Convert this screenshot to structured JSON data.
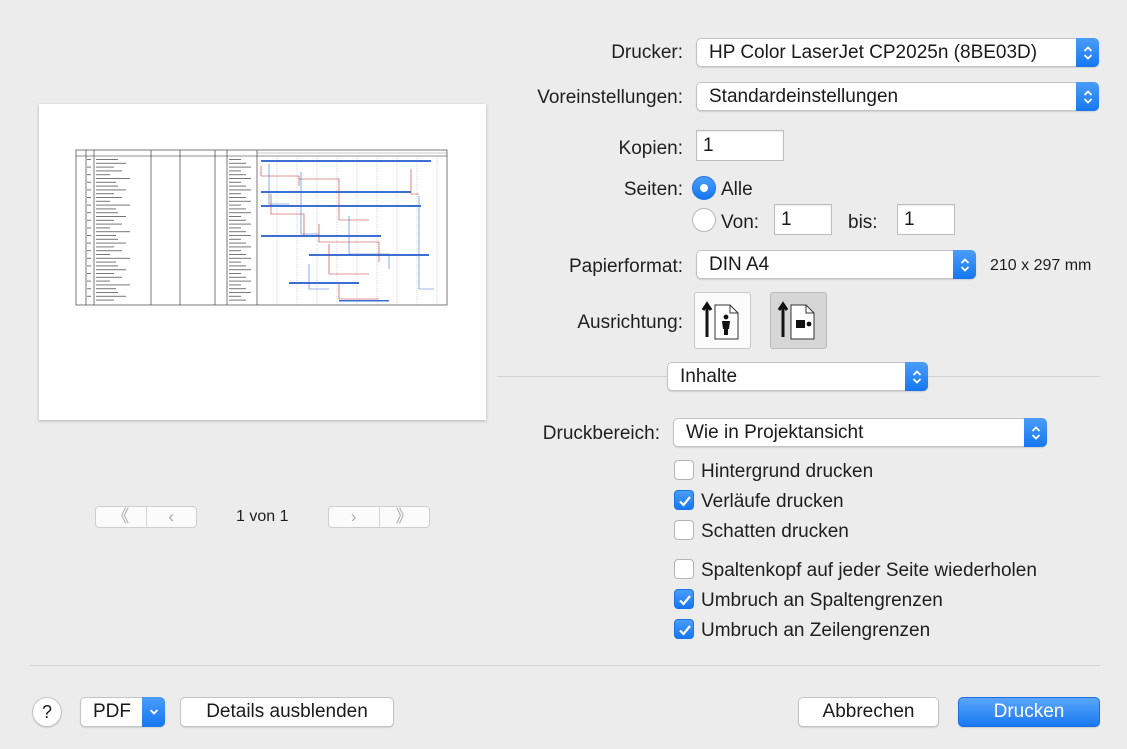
{
  "printer": {
    "label": "Drucker:",
    "value": "HP Color LaserJet CP2025n (8BE03D)"
  },
  "presets": {
    "label": "Voreinstellungen:",
    "value": "Standardeinstellungen"
  },
  "copies": {
    "label": "Kopien:",
    "value": "1"
  },
  "pages": {
    "label": "Seiten:",
    "all_label": "Alle",
    "from_label": "Von:",
    "from_value": "1",
    "to_label": "bis:",
    "to_value": "1",
    "selected": "all"
  },
  "paper": {
    "label": "Papierformat:",
    "value": "DIN A4",
    "size": "210 x 297 mm"
  },
  "orientation": {
    "label": "Ausrichtung:",
    "selected": "landscape"
  },
  "section": {
    "value": "Inhalte"
  },
  "print_area": {
    "label": "Druckbereich:",
    "value": "Wie in Projektansicht"
  },
  "options": [
    {
      "label": "Hintergrund drucken",
      "checked": false
    },
    {
      "label": "Verläufe drucken",
      "checked": true
    },
    {
      "label": "Schatten drucken",
      "checked": false
    },
    {
      "label": "Spaltenkopf auf jeder Seite wiederholen",
      "checked": false
    },
    {
      "label": "Umbruch an Spaltengrenzen",
      "checked": true
    },
    {
      "label": "Umbruch an Zeilengrenzen",
      "checked": true
    }
  ],
  "pager": {
    "page_text": "1 von 1",
    "first": "《",
    "prev": "‹",
    "next": "›",
    "last": "》"
  },
  "footer": {
    "help": "?",
    "pdf": "PDF",
    "details": "Details ausblenden",
    "cancel": "Abbrechen",
    "print": "Drucken"
  },
  "colors": {
    "accent": "#1a78f2",
    "background": "#ececec"
  }
}
